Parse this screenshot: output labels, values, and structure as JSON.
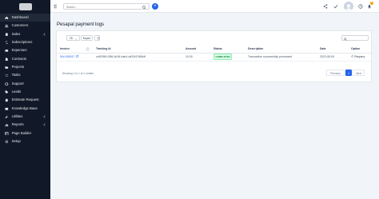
{
  "sidebar": {
    "items": [
      {
        "label": "Dashboard",
        "icon": "home-icon",
        "has_submenu": false,
        "active": true
      },
      {
        "label": "Customers",
        "icon": "users-icon",
        "has_submenu": false,
        "active": false
      },
      {
        "label": "Sales",
        "icon": "receipt-icon",
        "has_submenu": true,
        "active": false
      },
      {
        "label": "Subscriptions",
        "icon": "repeat-icon",
        "has_submenu": false,
        "active": false
      },
      {
        "label": "Expenses",
        "icon": "wallet-icon",
        "has_submenu": false,
        "active": false
      },
      {
        "label": "Contracts",
        "icon": "document-icon",
        "has_submenu": false,
        "active": false
      },
      {
        "label": "Projects",
        "icon": "folder-icon",
        "has_submenu": false,
        "active": false
      },
      {
        "label": "Tasks",
        "icon": "checklist-icon",
        "has_submenu": false,
        "active": false
      },
      {
        "label": "Support",
        "icon": "lifebuoy-icon",
        "has_submenu": false,
        "active": false
      },
      {
        "label": "Leads",
        "icon": "tag-icon",
        "has_submenu": false,
        "active": false
      },
      {
        "label": "Estimate Request",
        "icon": "clipboard-icon",
        "has_submenu": false,
        "active": false
      },
      {
        "label": "Knowledge Base",
        "icon": "book-icon",
        "has_submenu": false,
        "active": false
      },
      {
        "label": "Utilities",
        "icon": "wrench-icon",
        "has_submenu": true,
        "active": false
      },
      {
        "label": "Reports",
        "icon": "chart-icon",
        "has_submenu": true,
        "active": false
      },
      {
        "label": "Page Builder",
        "icon": "layout-icon",
        "has_submenu": false,
        "active": false
      },
      {
        "label": "Setup",
        "icon": "gear-icon",
        "has_submenu": false,
        "active": false
      }
    ]
  },
  "topbar": {
    "search_placeholder": "Search...",
    "quick_add_label": "+",
    "icons": [
      "share-icon",
      "check-icon",
      "clock-icon",
      "bell-icon"
    ],
    "notification_count": "2"
  },
  "page": {
    "title": "Pesapal payment logs"
  },
  "toolbar": {
    "page_size": "25",
    "export_label": "Export"
  },
  "table": {
    "columns": [
      "Invoice",
      "Tracking Id",
      "Amount",
      "Status",
      "Description",
      "Date",
      "Option"
    ],
    "rows": [
      {
        "invoice": "INV-000017",
        "tracking_id": "cd92056-f286-4b34-bab4-dd32f47686df",
        "amount": "10.00",
        "status": "COMPLETED",
        "description": "Transaction successfully processed",
        "date": "2023-08-09",
        "option": "Requery"
      }
    ]
  },
  "footer": {
    "info": "Showing 1 to 1 of 1 entries",
    "previous_label": "Previous",
    "current_page": "1",
    "next_label": "Next"
  },
  "colors": {
    "sidebar_bg": "#111827",
    "accent": "#2563eb",
    "success": "#15803d",
    "notification": "#f59e0b"
  }
}
